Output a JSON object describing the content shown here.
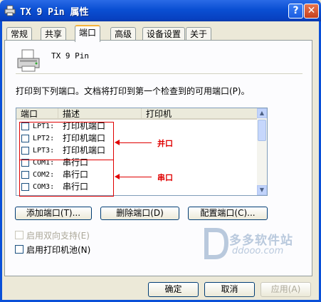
{
  "window": {
    "title": "TX 9 Pin 属性"
  },
  "tabs": [
    "常规",
    "共享",
    "端口",
    "高级",
    "设备设置",
    "关于"
  ],
  "active_tab": "端口",
  "printer_name": "TX 9 Pin",
  "instruction": "打印到下列端口。文档将打印到第一个检查到的可用端口(P)。",
  "port_list": {
    "headers": [
      "端口",
      "描述",
      "打印机"
    ],
    "rows": [
      {
        "port": "LPT1:",
        "desc": "打印机端口"
      },
      {
        "port": "LPT2:",
        "desc": "打印机端口"
      },
      {
        "port": "LPT3:",
        "desc": "打印机端口"
      },
      {
        "port": "COM1:",
        "desc": "串行口"
      },
      {
        "port": "COM2:",
        "desc": "串行口"
      },
      {
        "port": "COM3:",
        "desc": "串行口"
      }
    ]
  },
  "annotations": {
    "parallel": "并口",
    "serial": "串口"
  },
  "buttons": {
    "add_port": "添加端口(T)...",
    "delete_port": "删除端口(D)",
    "config_port": "配置端口(C)..."
  },
  "checkboxes": {
    "bidirectional": "启用双向支持(E)",
    "pooling": "启用打印机池(N)"
  },
  "watermark": {
    "text": "多多软件站",
    "url": "ddooo.com"
  },
  "dialog_buttons": {
    "ok": "确定",
    "cancel": "取消",
    "apply": "应用(A)"
  },
  "colors": {
    "title_bar": "#0a4fd3",
    "annotation": "#e00000"
  }
}
